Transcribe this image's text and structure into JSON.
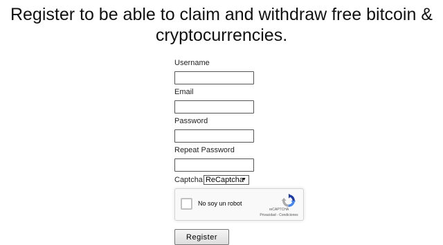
{
  "heading": "Register to be able to claim and withdraw free bitcoin & cryptocurrencies.",
  "form": {
    "username_label": "Username",
    "username_value": "",
    "email_label": "Email",
    "email_value": "",
    "password_label": "Password",
    "password_value": "",
    "repeat_password_label": "Repeat Password",
    "repeat_password_value": "",
    "captcha_label": "Captcha",
    "captcha_selected": "ReCaptcha",
    "submit_label": "Register"
  },
  "recaptcha": {
    "checkbox_label": "No soy un robot",
    "checked": false,
    "brand": "reCAPTCHA",
    "links": "Privacidad - Condiciones"
  },
  "colors": {
    "recaptcha_blue": "#1c3aa9",
    "recaptcha_light_blue": "#4285f4",
    "recaptcha_grey": "#ababab"
  }
}
